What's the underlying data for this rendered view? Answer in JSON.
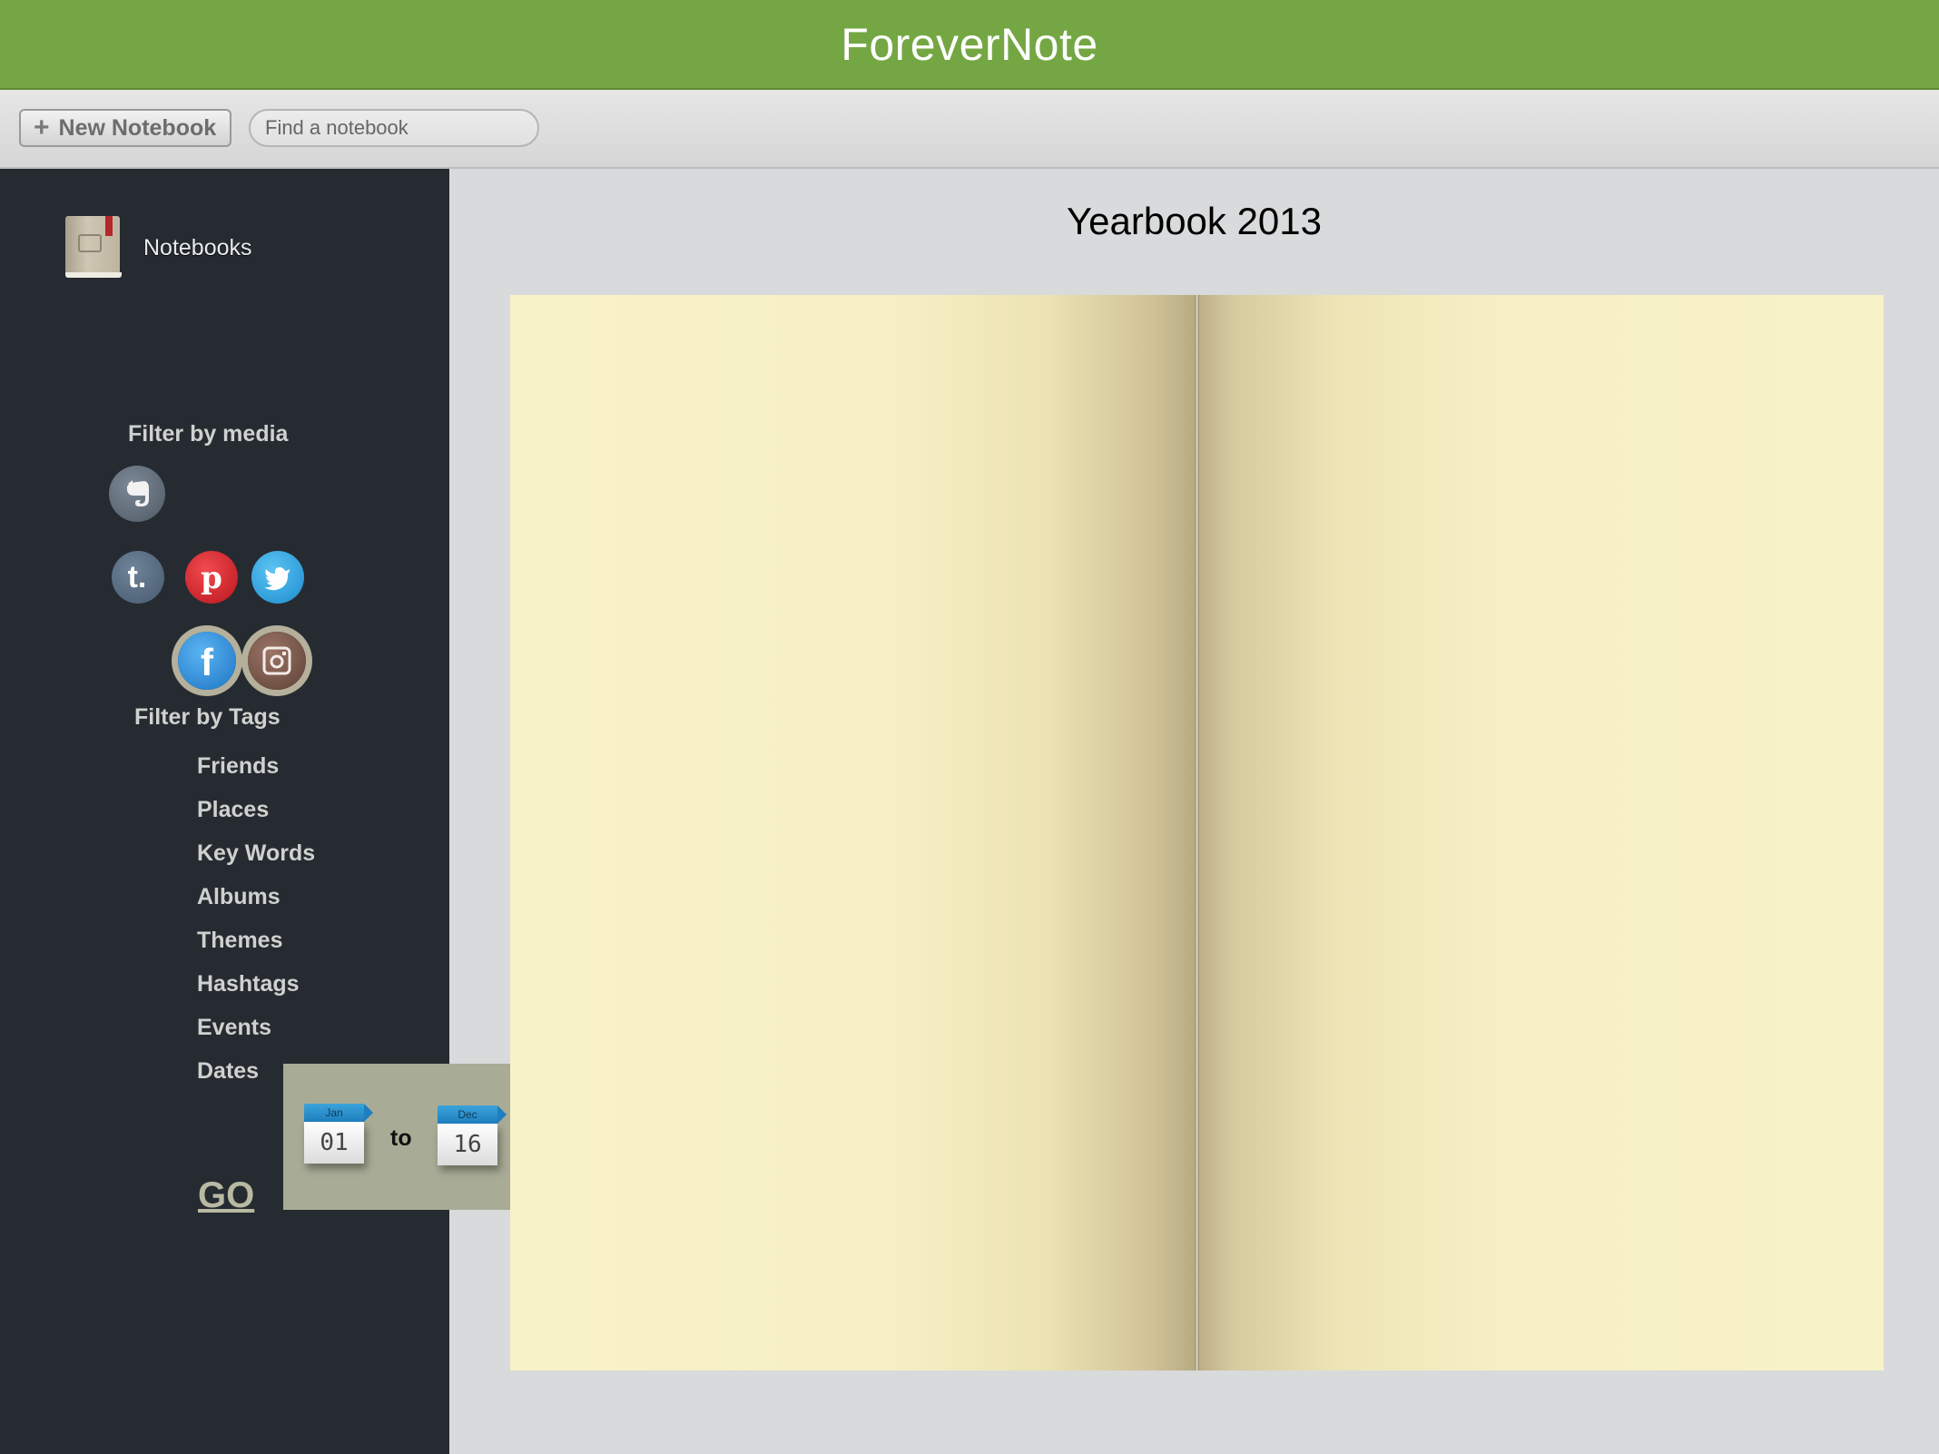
{
  "app": {
    "title": "ForeverNote"
  },
  "toolbar": {
    "new_notebook_label": "New Notebook",
    "search_placeholder": "Find a notebook"
  },
  "sidebar": {
    "notebooks_label": "Notebooks",
    "filter_media_title": "Filter by media",
    "media": [
      {
        "name": "evernote",
        "icon": "evernote-icon",
        "selected": false,
        "color": "#5f6b78"
      },
      {
        "name": "facebook",
        "icon": "facebook-icon",
        "selected": true,
        "color": "#2b88d8"
      },
      {
        "name": "instagram",
        "icon": "instagram-icon",
        "selected": true,
        "color": "#7a5a4e"
      },
      {
        "name": "tumblr",
        "icon": "tumblr-icon",
        "selected": false,
        "color": "#56697e"
      },
      {
        "name": "pinterest",
        "icon": "pinterest-icon",
        "selected": false,
        "color": "#d6262e"
      },
      {
        "name": "twitter",
        "icon": "twitter-icon",
        "selected": false,
        "color": "#2ea5e2"
      }
    ],
    "filter_tags_title": "Filter by Tags",
    "tags": [
      "Friends",
      "Places",
      "Key Words",
      "Albums",
      "Themes",
      "Hashtags",
      "Events",
      "Dates"
    ],
    "date_range": {
      "from": {
        "month": "Jan",
        "day": "01"
      },
      "connector": "to",
      "to": {
        "month": "Dec",
        "day": "16"
      }
    },
    "go_label": "GO"
  },
  "main": {
    "title": "Yearbook 2013"
  }
}
